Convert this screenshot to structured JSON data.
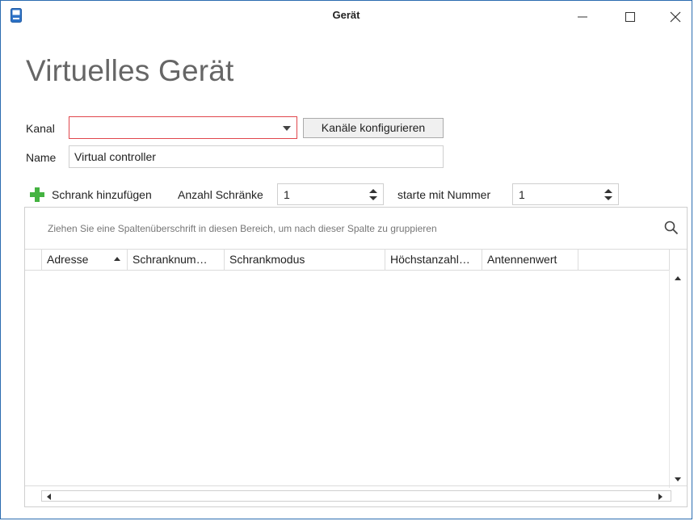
{
  "window": {
    "title": "Gerät",
    "controls": {
      "minimize": "minimize-icon",
      "maximize": "maximize-icon",
      "close": "close-icon"
    }
  },
  "heading": "Virtuelles Gerät",
  "form": {
    "kanal_label": "Kanal",
    "kanal_value": "",
    "configure_button": "Kanäle konfigurieren",
    "name_label": "Name",
    "name_value": "Virtual controller"
  },
  "toolbar": {
    "add_cabinet": "Schrank hinzufügen",
    "count_label": "Anzahl Schränke",
    "count_value": "1",
    "start_label": "starte mit Nummer",
    "start_value": "1"
  },
  "grid": {
    "group_hint": "Ziehen Sie eine Spaltenüberschrift in diesen Bereich, um nach dieser Spalte zu gruppieren",
    "columns": [
      "Adresse",
      "Schranknum…",
      "Schrankmodus",
      "Höchstanzahl…",
      "Antennenwert"
    ],
    "rows": []
  },
  "colors": {
    "accent_border": "#e0474c",
    "add_icon": "#44b341",
    "window_border": "#2b6cb0"
  }
}
